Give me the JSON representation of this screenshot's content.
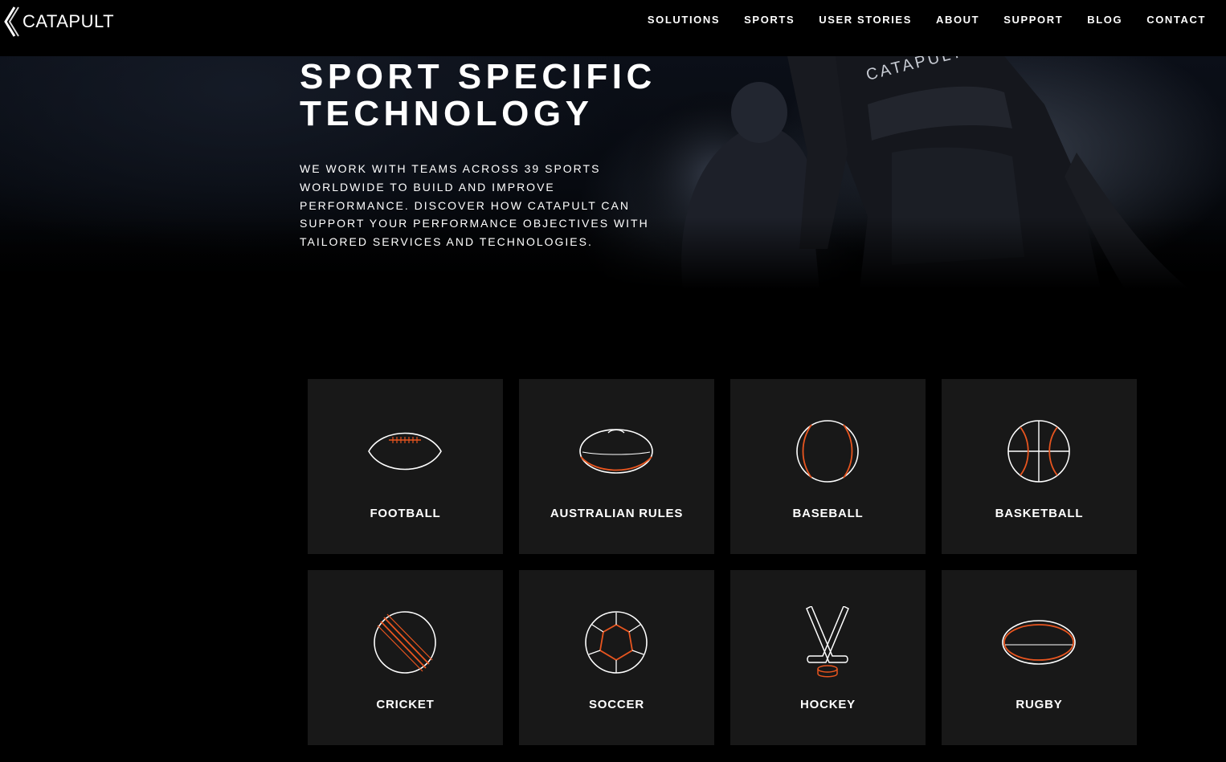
{
  "header": {
    "logo_text": "CATAPULT",
    "nav": [
      "SOLUTIONS",
      "SPORTS",
      "USER STORIES",
      "ABOUT",
      "SUPPORT",
      "BLOG",
      "CONTACT"
    ]
  },
  "hero": {
    "title_line1": "SPORT SPECIFIC",
    "title_line2": "TECHNOLOGY",
    "description": "WE WORK WITH TEAMS ACROSS 39 SPORTS WORLDWIDE TO BUILD AND IMPROVE PERFORMANCE. DISCOVER HOW CATAPULT CAN SUPPORT YOUR PERFORMANCE OBJECTIVES WITH TAILORED SERVICES AND TECHNOLOGIES.",
    "shirt_text": "CATAPULT"
  },
  "sports": [
    {
      "label": "FOOTBALL",
      "icon": "football-icon"
    },
    {
      "label": "AUSTRALIAN RULES",
      "icon": "australian-rules-ball-icon"
    },
    {
      "label": "BASEBALL",
      "icon": "baseball-icon"
    },
    {
      "label": "BASKETBALL",
      "icon": "basketball-icon"
    },
    {
      "label": "CRICKET",
      "icon": "cricket-ball-icon"
    },
    {
      "label": "SOCCER",
      "icon": "soccer-ball-icon"
    },
    {
      "label": "HOCKEY",
      "icon": "hockey-sticks-icon"
    },
    {
      "label": "RUGBY",
      "icon": "rugby-ball-icon"
    }
  ],
  "colors": {
    "accent": "#e8551f",
    "tile_background": "#181818",
    "page_background": "#000000",
    "text": "#ffffff"
  }
}
